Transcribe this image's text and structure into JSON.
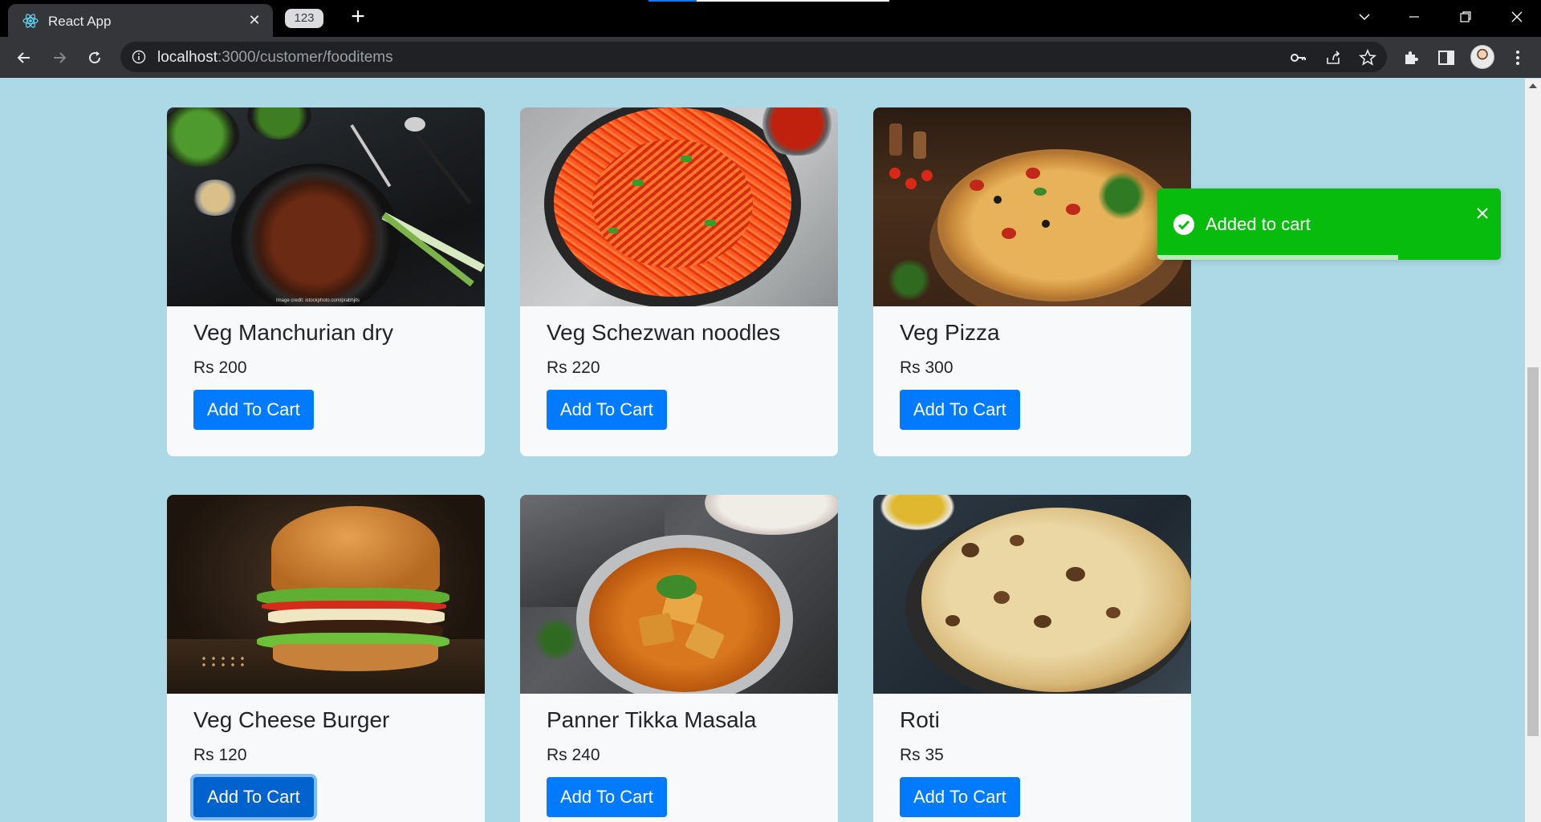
{
  "browser": {
    "tab_title": "React App",
    "tab_group_label": "123",
    "url_host": "localhost",
    "url_path": ":3000/customer/fooditems"
  },
  "food_items": [
    {
      "name": "Veg Manchurian dry",
      "price": "Rs 200",
      "button": "Add To Cart",
      "image": "manchurian-image"
    },
    {
      "name": "Veg Schezwan noodles",
      "price": "Rs 220",
      "button": "Add To Cart",
      "image": "noodles-image"
    },
    {
      "name": "Veg Pizza",
      "price": "Rs 300",
      "button": "Add To Cart",
      "image": "pizza-image"
    },
    {
      "name": "Veg Cheese Burger",
      "price": "Rs 120",
      "button": "Add To Cart",
      "image": "burger-image"
    },
    {
      "name": "Panner Tikka Masala",
      "price": "Rs 240",
      "button": "Add To Cart",
      "image": "paneer-image"
    },
    {
      "name": "Roti",
      "price": "Rs 35",
      "button": "Add To Cart",
      "image": "roti-image"
    }
  ],
  "image_credit": "Image credit: istockphoto.com/prabhjits",
  "toast": {
    "message": "Added to cart",
    "progress": 0.7,
    "color": "#07bc0c"
  },
  "colors": {
    "page_background": "#add8e6",
    "button": "#007bff"
  }
}
